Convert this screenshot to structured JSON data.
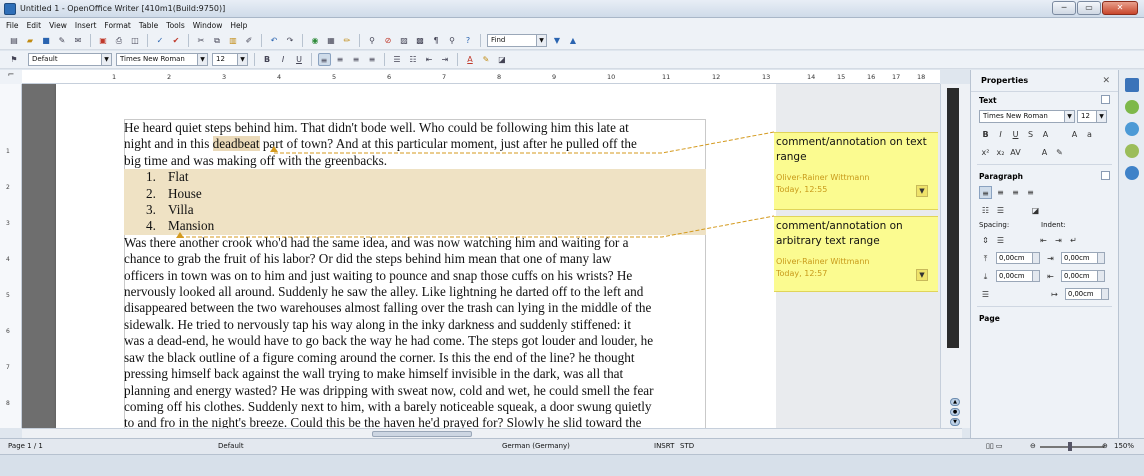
{
  "window": {
    "title": "Untitled 1 - OpenOffice Writer [410m1(Build:9750)]"
  },
  "menu": [
    "File",
    "Edit",
    "View",
    "Insert",
    "Format",
    "Table",
    "Tools",
    "Window",
    "Help"
  ],
  "toolbar": {
    "find_value": "Find",
    "style_value": "Default",
    "font_value": "Times New Roman",
    "size_value": "12",
    "bold": "B",
    "italic": "I",
    "underline": "U"
  },
  "ruler": {
    "top_ticks": [
      "1",
      "2",
      "3",
      "4",
      "5",
      "6",
      "7",
      "8",
      "9",
      "10",
      "11",
      "12",
      "13",
      "14",
      "15",
      "16",
      "17",
      "18"
    ],
    "left_ticks": [
      "1",
      "2",
      "3",
      "4",
      "5",
      "6",
      "7",
      "8"
    ]
  },
  "document": {
    "para1_before": "He heard quiet steps behind him. That didn't bode well. Who could be following him this late at",
    "para1_line2_a": "night and in this ",
    "para1_highlight": "deadbeat",
    "para1_line2_b": " part of town? And at this particular moment, just after he pulled off the",
    "para1_line3": "big time and was making off with the greenbacks.",
    "list": [
      {
        "num": "1.",
        "text": "Flat"
      },
      {
        "num": "2.",
        "text": "House"
      },
      {
        "num": "3.",
        "text": "Villa"
      },
      {
        "num": "4.",
        "text": "Mansion"
      }
    ],
    "para2_lines": [
      "Was there another crook who'd had the same idea, and was now watching him and waiting for a",
      "chance to grab the fruit of his labor? Or did the steps behind him mean that one of many law",
      "officers in town was on to him and just waiting to pounce and snap those cuffs on his wrists? He",
      "nervously looked all around. Suddenly he saw the alley. Like lightning he darted off to the left and",
      "disappeared between the two warehouses almost falling over the trash can lying in the middle of the",
      "sidewalk. He tried to nervously tap his way along in the inky darkness and suddenly stiffened: it",
      "was a dead-end, he would have to go back the way he had come. The steps got louder and louder, he",
      "saw the black outline of a figure coming around the corner. Is this the end of the line? he thought",
      "pressing himself back against the wall trying to make himself invisible in the dark, was all that",
      "planning and energy wasted? He was dripping with sweat now, cold and wet, he could smell the fear",
      "coming off his clothes. Suddenly next to him, with a barely noticeable squeak, a door swung quietly",
      "to and fro in the night's breeze. Could this be the haven he'd prayed for? Slowly he slid toward the"
    ]
  },
  "comments": [
    {
      "text": "comment/annotation on text range",
      "author": "Oliver-Rainer Wittmann",
      "time": "Today, 12:55"
    },
    {
      "text": "comment/annotation on arbitrary text range",
      "author": "Oliver-Rainer Wittmann",
      "time": "Today, 12:57"
    }
  ],
  "sidebar": {
    "title": "Properties",
    "text_section": "Text",
    "font": "Times New Roman",
    "size": "12",
    "paragraph_section": "Paragraph",
    "spacing_label": "Spacing:",
    "indent_label": "Indent:",
    "spin_values": [
      "0,00cm",
      "0,00cm",
      "0,00cm",
      "0,00cm",
      "0,00cm"
    ],
    "page_section": "Page"
  },
  "status": {
    "page": "Page 1 / 1",
    "style": "Default",
    "language": "German (Germany)",
    "insert": "INSRT",
    "std": "STD",
    "zoom": "150%"
  },
  "colors": {
    "comment_bg": "#fbfb90",
    "highlight": "#ead9b8",
    "anchor": "#d49a1e"
  }
}
